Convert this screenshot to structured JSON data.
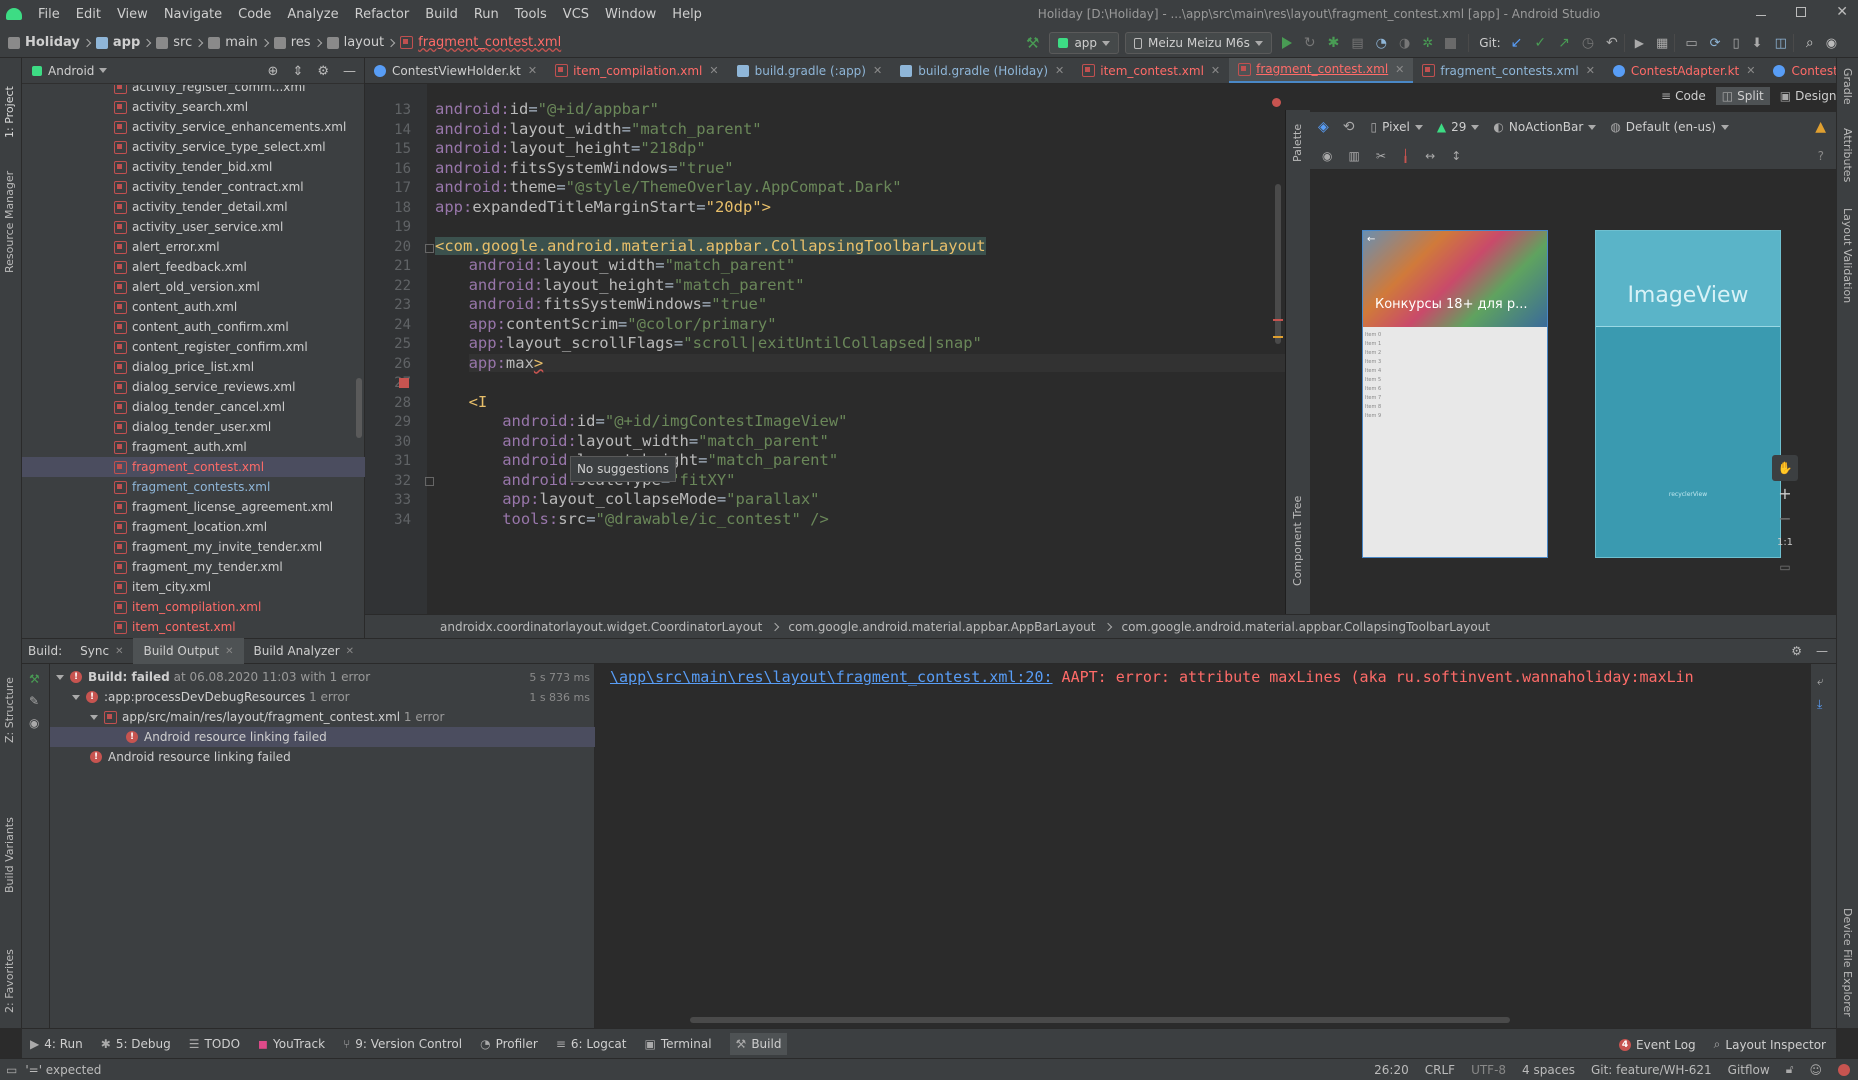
{
  "window": {
    "title": "Holiday [D:\\Holiday] - ...\\app\\src\\main\\res\\layout\\fragment_contest.xml [app] - Android Studio"
  },
  "menu": [
    "File",
    "Edit",
    "View",
    "Navigate",
    "Code",
    "Analyze",
    "Refactor",
    "Build",
    "Run",
    "Tools",
    "VCS",
    "Window",
    "Help"
  ],
  "breadcrumbs": [
    "Holiday",
    "app",
    "src",
    "main",
    "res",
    "layout",
    "fragment_contest.xml"
  ],
  "run": {
    "config": "app",
    "device": "Meizu Meizu M6s",
    "git_label": "Git:"
  },
  "project": {
    "view": "Android",
    "files": [
      "activity_register_comm...xml",
      "activity_search.xml",
      "activity_service_enhancements.xml",
      "activity_service_type_select.xml",
      "activity_tender_bid.xml",
      "activity_tender_contract.xml",
      "activity_tender_detail.xml",
      "activity_user_service.xml",
      "alert_error.xml",
      "alert_feedback.xml",
      "alert_old_version.xml",
      "content_auth.xml",
      "content_auth_confirm.xml",
      "content_register_confirm.xml",
      "dialog_price_list.xml",
      "dialog_service_reviews.xml",
      "dialog_tender_cancel.xml",
      "dialog_tender_user.xml",
      "fragment_auth.xml",
      "fragment_contest.xml",
      "fragment_contests.xml",
      "fragment_license_agreement.xml",
      "fragment_location.xml",
      "fragment_my_invite_tender.xml",
      "fragment_my_tender.xml",
      "item_city.xml",
      "item_compilation.xml",
      "item_contest.xml"
    ],
    "selected": "fragment_contest.xml"
  },
  "tabs": [
    "ContestViewHolder.kt",
    "item_compilation.xml",
    "build.gradle (:app)",
    "build.gradle (Holiday)",
    "item_contest.xml",
    "fragment_contest.xml",
    "fragment_contests.xml",
    "ContestAdapter.kt",
    "ContestFragment.kt"
  ],
  "view_modes": [
    "Code",
    "Split",
    "Design"
  ],
  "editor": {
    "lines": [
      {
        "n": "13",
        "ns": "android:",
        "attr": "id",
        "val": "\"@+id/appbar\""
      },
      {
        "n": "14",
        "ns": "android:",
        "attr": "layout_width",
        "val": "\"match_parent\""
      },
      {
        "n": "15",
        "ns": "android:",
        "attr": "layout_height",
        "val": "\"218dp\""
      },
      {
        "n": "16",
        "ns": "android:",
        "attr": "fitsSystemWindows",
        "val": "\"true\""
      },
      {
        "n": "17",
        "ns": "android:",
        "attr": "theme",
        "val": "\"@style/ThemeOverlay.AppCompat.Dark\""
      },
      {
        "n": "18",
        "ns": "app:",
        "attr": "expandedTitleMarginStart",
        "val": "\"20dp\">"
      },
      {
        "n": "19",
        "ns": "",
        "attr": "",
        "val": ""
      },
      {
        "n": "20",
        "tag": "<com.google.android.material.appbar.CollapsingToolbarLayout"
      },
      {
        "n": "21",
        "ns": "android:",
        "attr": "layout_width",
        "val": "\"match_parent\""
      },
      {
        "n": "22",
        "ns": "android:",
        "attr": "layout_height",
        "val": "\"match_parent\""
      },
      {
        "n": "23",
        "ns": "android:",
        "attr": "fitsSystemWindows",
        "val": "\"true\""
      },
      {
        "n": "24",
        "ns": "app:",
        "attr": "contentScrim",
        "val": "\"@color/primary\""
      },
      {
        "n": "25",
        "ns": "app:",
        "attr": "layout_scrollFlags",
        "val": "\"scroll|exitUntilCollapsed|snap\""
      },
      {
        "n": "26",
        "ns": "app:",
        "attr": "max",
        "val": ">"
      },
      {
        "n": "27",
        "ns": "",
        "attr": "",
        "val": ""
      },
      {
        "n": "28",
        "tag": "<I"
      },
      {
        "n": "29",
        "ns": "android:",
        "attr": "id",
        "val": "\"@+id/imgContestImageView\""
      },
      {
        "n": "30",
        "ns": "android:",
        "attr": "layout_width",
        "val": "\"match_parent\""
      },
      {
        "n": "31",
        "ns": "android:",
        "attr": "layout_height",
        "val": "\"match_parent\""
      },
      {
        "n": "32",
        "ns": "android:",
        "attr": "scaleType",
        "val": "\"fitXY\""
      },
      {
        "n": "33",
        "ns": "app:",
        "attr": "layout_collapseMode",
        "val": "\"parallax\""
      },
      {
        "n": "34",
        "ns": "tools:",
        "attr": "src",
        "val": "\"@drawable/ic_contest\" />"
      }
    ],
    "popup": "No suggestions"
  },
  "preview": {
    "device": "Pixel",
    "api": "29",
    "theme": "NoActionBar",
    "locale": "Default (en-us)",
    "phone_caption": "Конкурсы 18+ для р...",
    "imageview_label": "ImageView",
    "recycler_label": "recyclerView",
    "items": [
      "Item 0",
      "Item 1",
      "Item 2",
      "Item 3",
      "Item 4",
      "Item 5",
      "Item 6",
      "Item 7",
      "Item 8",
      "Item 9"
    ],
    "zoom_label": "1:1",
    "side_labels": {
      "palette": "Palette",
      "component_tree": "Component Tree"
    }
  },
  "pathbar": [
    "androidx.coordinatorlayout.widget.CoordinatorLayout",
    "com.google.android.material.appbar.AppBarLayout",
    "com.google.android.material.appbar.CollapsingToolbarLayout"
  ],
  "build": {
    "label": "Build:",
    "tabs": [
      "Sync",
      "Build Output",
      "Build Analyzer"
    ],
    "tree": [
      {
        "text": "Build: failed",
        "extra": "at 06.08.2020 11:03 with 1 error",
        "time": "5 s 773 ms"
      },
      {
        "text": ":app:processDevDebugResources",
        "extra": "1 error",
        "time": "1 s 836 ms"
      },
      {
        "text": "app/src/main/res/layout/fragment_contest.xml",
        "extra": "1 error",
        "time": ""
      },
      {
        "text": "Android resource linking failed",
        "extra": "",
        "time": ""
      },
      {
        "text": "Android resource linking failed",
        "extra": "",
        "time": ""
      }
    ],
    "output_link": "\\app\\src\\main\\res\\layout\\fragment_contest.xml:20:",
    "output_error": " AAPT: error: attribute maxLines (aka ru.softinvent.wannaholiday:maxLin"
  },
  "toolwindows": [
    "4: Run",
    "5: Debug",
    "TODO",
    "YouTrack",
    "9: Version Control",
    "Profiler",
    "6: Logcat",
    "Terminal",
    "Build"
  ],
  "toolwindows_right": [
    "Event Log",
    "Layout Inspector"
  ],
  "event_count": "4",
  "status": {
    "message": "'=' expected",
    "position": "26:20",
    "line_sep": "CRLF",
    "encoding": "UTF-8",
    "indent": "4 spaces",
    "git": "Git: feature/WH-621",
    "gitflow": "Gitflow"
  },
  "left_strip": [
    "1: Project",
    "Resource Manager",
    "Z: Structure",
    "Build Variants",
    "2: Favorites"
  ],
  "right_strip": [
    "Gradle",
    "Attributes",
    "Layout Validation",
    "Device File Explorer"
  ],
  "colors": {
    "accent": "#4a88c7",
    "error": "#c75450",
    "link": "#589df6",
    "run": "#499c54"
  }
}
